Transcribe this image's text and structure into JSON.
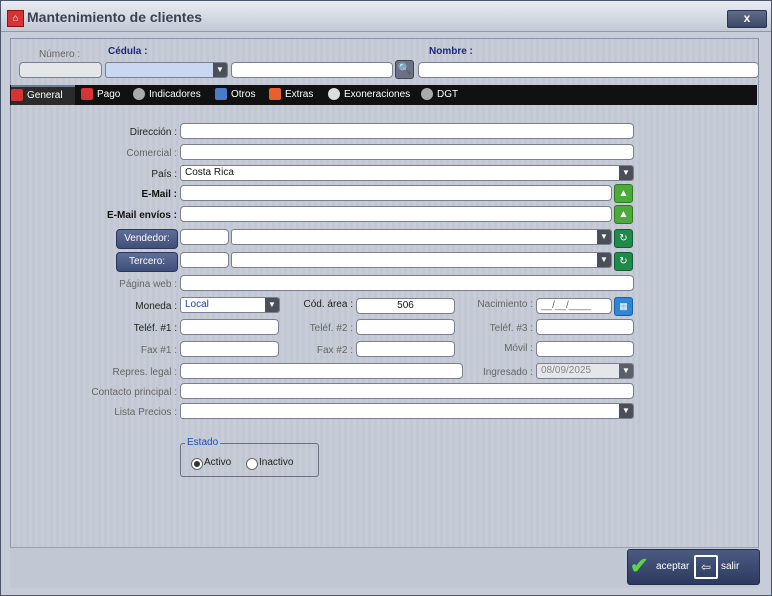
{
  "window": {
    "title": "Mantenimiento de clientes",
    "close": "x"
  },
  "header": {
    "numero_label": "Número :",
    "cedula_label": "Cédula :",
    "nombre_label": "Nombre :"
  },
  "tabs": [
    {
      "label": "General",
      "icon": "store-icon"
    },
    {
      "label": "Pago",
      "icon": "payment-icon"
    },
    {
      "label": "Indicadores",
      "icon": "gear-icon"
    },
    {
      "label": "Otros",
      "icon": "list-icon"
    },
    {
      "label": "Extras",
      "icon": "extras-icon"
    },
    {
      "label": "Exoneraciones",
      "icon": "info-icon"
    },
    {
      "label": "DGT",
      "icon": "gear-icon"
    }
  ],
  "form": {
    "direccion_label": "Dirección :",
    "comercial_label": "Comercial :",
    "pais_label": "País :",
    "pais_value": "Costa Rica",
    "email_label": "E-Mail :",
    "email_envios_label": "E-Mail envíos :",
    "vendedor_label": "Vendedor:",
    "tercero_label": "Tercero:",
    "pagina_web_label": "Página web :",
    "moneda_label": "Moneda :",
    "moneda_value": "Local",
    "cod_area_label": "Cód. área :",
    "cod_area_value": "506",
    "nacimiento_label": "Nacimiento :",
    "nacimiento_value": "__/__/____",
    "telef1_label": "Teléf. #1 :",
    "telef2_label": "Teléf. #2 :",
    "telef3_label": "Teléf. #3 :",
    "fax1_label": "Fax #1 :",
    "fax2_label": "Fax #2 :",
    "movil_label": "Móvil :",
    "repres_label": "Repres. legal :",
    "ingresado_label": "Ingresado :",
    "ingresado_value": "08/09/2025",
    "contacto_label": "Contacto principal :",
    "lista_precios_label": "Lista Precios :"
  },
  "estado": {
    "legend": "Estado",
    "activo": "Activo",
    "inactivo": "Inactivo"
  },
  "footer": {
    "aceptar": "aceptar",
    "salir": "salir"
  },
  "colors": {
    "accent": "#3f4f79",
    "green": "#4caa3c",
    "legend_blue": "#1a4fb0"
  }
}
